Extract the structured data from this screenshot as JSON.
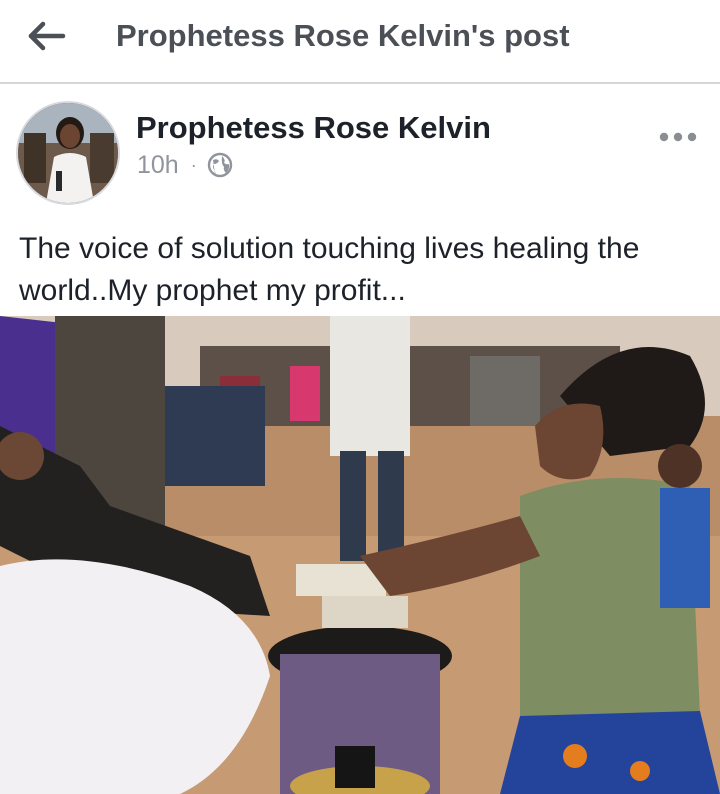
{
  "topbar": {
    "title": "Prophetess Rose Kelvin's post",
    "back_icon": "arrow-left-icon"
  },
  "post": {
    "author": "Prophetess Rose Kelvin",
    "time": "10h",
    "separator": "·",
    "privacy_icon": "globe-icon",
    "more_icon": "more-horizontal-icon",
    "text": "The voice of solution touching lives healing the world..My prophet my profit..."
  },
  "colors": {
    "title_gray": "#4b4f56",
    "text_dark": "#1d2129",
    "meta_gray": "#90949c"
  }
}
